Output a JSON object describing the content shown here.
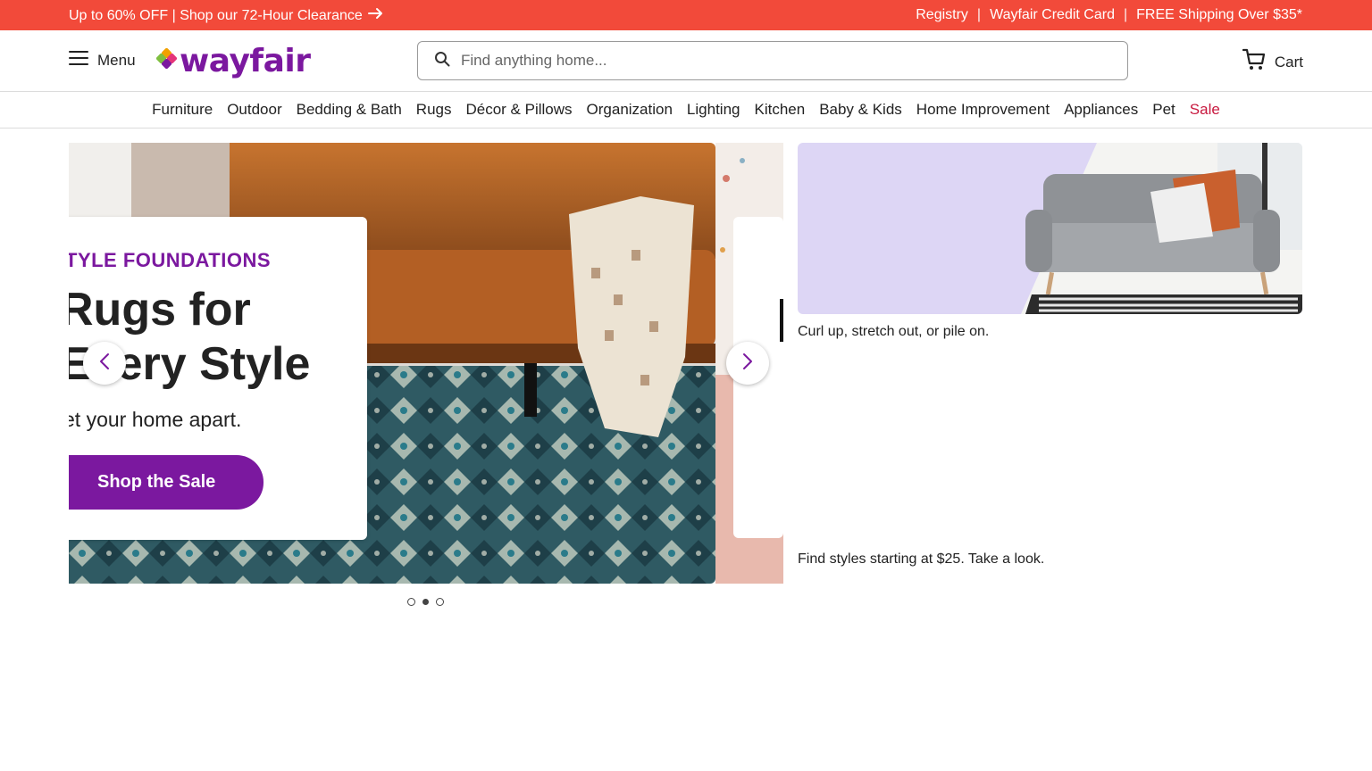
{
  "promo": {
    "left_text": "Up to 60% OFF | Shop our 72-Hour Clearance",
    "links": [
      "Registry",
      "Wayfair Credit Card",
      "FREE Shipping Over $35*"
    ],
    "separator": "|",
    "bg_color": "#f24a3a"
  },
  "header": {
    "menu_label": "Menu",
    "logo_text": "wayfair",
    "search_placeholder": "Find anything home...",
    "cart_label": "Cart",
    "brand_color": "#7b189f"
  },
  "categories": [
    {
      "label": "Furniture"
    },
    {
      "label": "Outdoor"
    },
    {
      "label": "Bedding & Bath"
    },
    {
      "label": "Rugs"
    },
    {
      "label": "Décor & Pillows"
    },
    {
      "label": "Organization"
    },
    {
      "label": "Lighting"
    },
    {
      "label": "Kitchen"
    },
    {
      "label": "Baby & Kids"
    },
    {
      "label": "Home Improvement"
    },
    {
      "label": "Appliances"
    },
    {
      "label": "Pet"
    },
    {
      "label": "Sale"
    }
  ],
  "hero": {
    "eyebrow": "TYLE FOUNDATIONS",
    "title_line1": "Rugs for",
    "title_line2": "Every Style",
    "subtitle": "et your home apart.",
    "cta": "Shop the Sale",
    "slide_count": 3,
    "active_slide": 2
  },
  "tiles": {
    "caption1": "Curl up, stretch out, or pile on.",
    "caption2": "Find styles starting at $25. Take a look."
  },
  "icons": {
    "menu": "hamburger-icon",
    "search": "search-icon",
    "cart": "cart-icon",
    "promo_arrow": "arrow-right-icon",
    "prev": "chevron-left-icon",
    "next": "chevron-right-icon"
  }
}
